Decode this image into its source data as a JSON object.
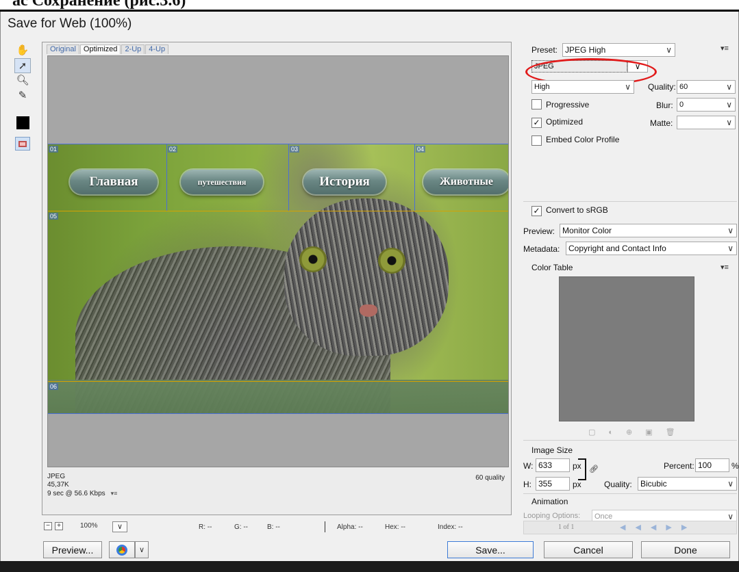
{
  "header_fragment": "ac  Сохранение (рис.3.6)",
  "dialog": {
    "title": "Save for Web (100%)"
  },
  "tabs": [
    "Original",
    "Optimized",
    "2-Up",
    "4-Up"
  ],
  "slices": [
    "01",
    "02",
    "03",
    "04",
    "05",
    "06"
  ],
  "nav_buttons": [
    "Главная",
    "путешествия",
    "История",
    "Животные"
  ],
  "preview_info": {
    "format": "JPEG",
    "size": "45,37K",
    "download_time": "9 sec @ 56.6 Kbps",
    "menu_glyph": "▾≡",
    "quality": "60 quality"
  },
  "status": {
    "zoom_minus": "−",
    "zoom_plus": "+",
    "zoom": "100%",
    "r": "R: --",
    "g": "G: --",
    "b": "B: --",
    "alpha": "Alpha: --",
    "hex": "Hex: --",
    "index": "Index: --"
  },
  "buttons": {
    "preview": "Preview...",
    "save": "Save...",
    "cancel": "Cancel",
    "done": "Done"
  },
  "settings": {
    "preset_label": "Preset:",
    "preset": "JPEG High",
    "format": "JPEG",
    "compression": "High",
    "quality_label": "Quality:",
    "quality": "60",
    "blur_label": "Blur:",
    "blur": "0",
    "matte_label": "Matte:",
    "matte": "",
    "progressive": "Progressive",
    "optimized": "Optimized",
    "embed_profile": "Embed Color Profile",
    "convert_srgb": "Convert to sRGB",
    "preview_label": "Preview:",
    "preview_value": "Monitor Color",
    "metadata_label": "Metadata:",
    "metadata_value": "Copyright and Contact Info",
    "color_table": "Color Table",
    "checkmark": "✓"
  },
  "image_size": {
    "title": "Image Size",
    "w_label": "W:",
    "w": "633",
    "h_label": "H:",
    "h": "355",
    "unit": "px",
    "percent_label": "Percent:",
    "percent": "100",
    "percent_unit": "%",
    "quality_label": "Quality:",
    "quality": "Bicubic"
  },
  "animation": {
    "title": "Animation",
    "looping_label": "Looping Options:",
    "looping": "Once",
    "frame": "1 of 1"
  },
  "colors": {
    "accent": "#3d7bd6",
    "annotation_oval": "#e11a1a",
    "slice_line": "#4a6fd8"
  }
}
